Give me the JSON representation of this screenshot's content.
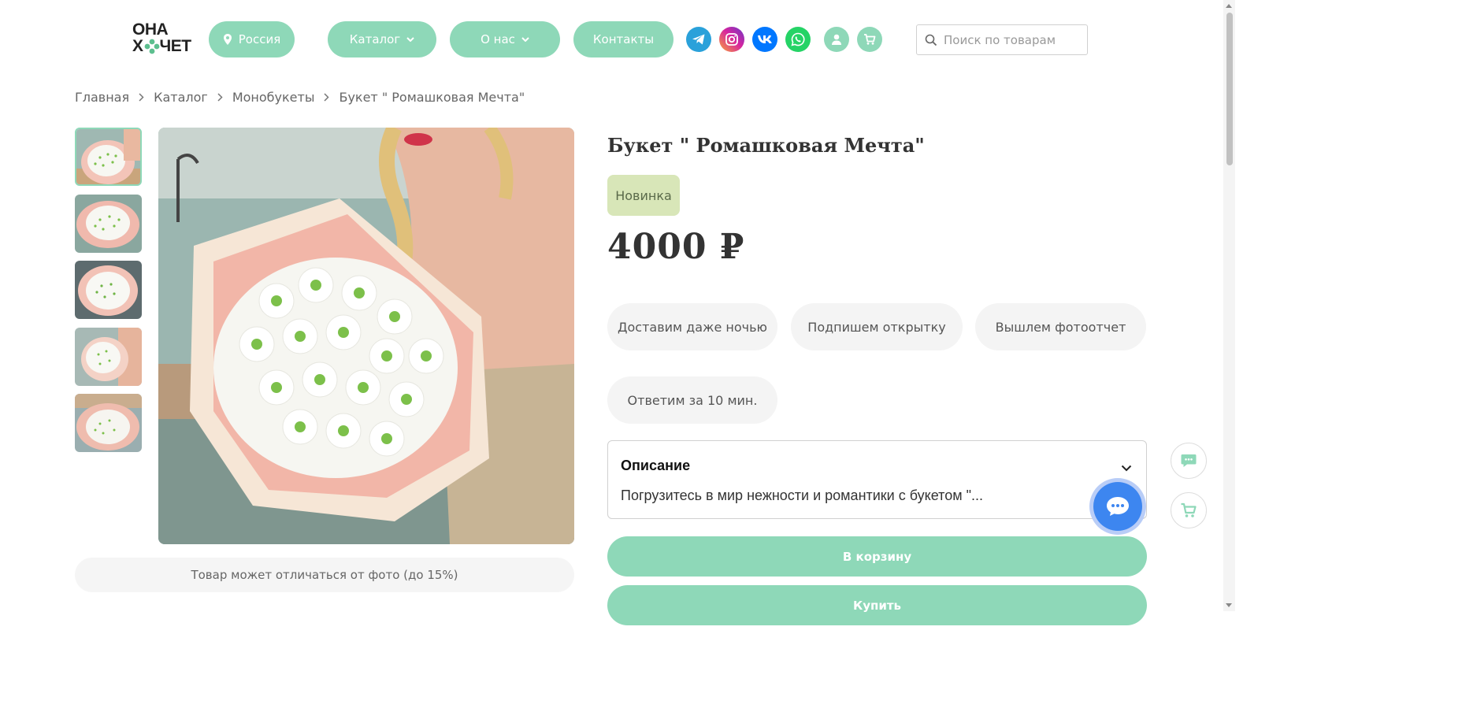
{
  "header": {
    "logo_line1": "ОНА",
    "logo_line2_a": "Х",
    "logo_line2_b": "ЧЕТ",
    "region_label": "Россия",
    "nav": [
      {
        "label": "Каталог"
      },
      {
        "label": "О нас"
      },
      {
        "label": "Контакты"
      }
    ],
    "social": [
      "telegram-icon",
      "instagram-icon",
      "vk-icon",
      "whatsapp-icon"
    ],
    "search_placeholder": "Поиск по товарам"
  },
  "breadcrumbs": [
    "Главная",
    "Каталог",
    "Монобукеты",
    "Букет \" Ромашковая Мечта\""
  ],
  "gallery": {
    "thumbnail_count": 5,
    "active_index": 0,
    "disclaimer": "Товар может отличаться от фото (до 15%)"
  },
  "product": {
    "title": "Букет \" Ромашковая Мечта\"",
    "badge": "Новинка",
    "price": "4000 ₽",
    "features": [
      "Доставим даже ночью",
      "Подпишем открытку",
      "Вышлем фотоотчет",
      "Ответим за 10 мин."
    ],
    "description_title": "Описание",
    "description_preview": "Погрузитесь в мир нежности и романтики с букетом \"...",
    "add_to_cart": "В корзину",
    "buy": "Купить"
  },
  "colors": {
    "accent": "#8ed8b8",
    "badge_bg": "#d8e6b8",
    "chat_blue": "#3d86f0",
    "telegram": "#2aa1da",
    "instagram": "#d6249f",
    "vk": "#0077ff",
    "whatsapp": "#25d366"
  }
}
